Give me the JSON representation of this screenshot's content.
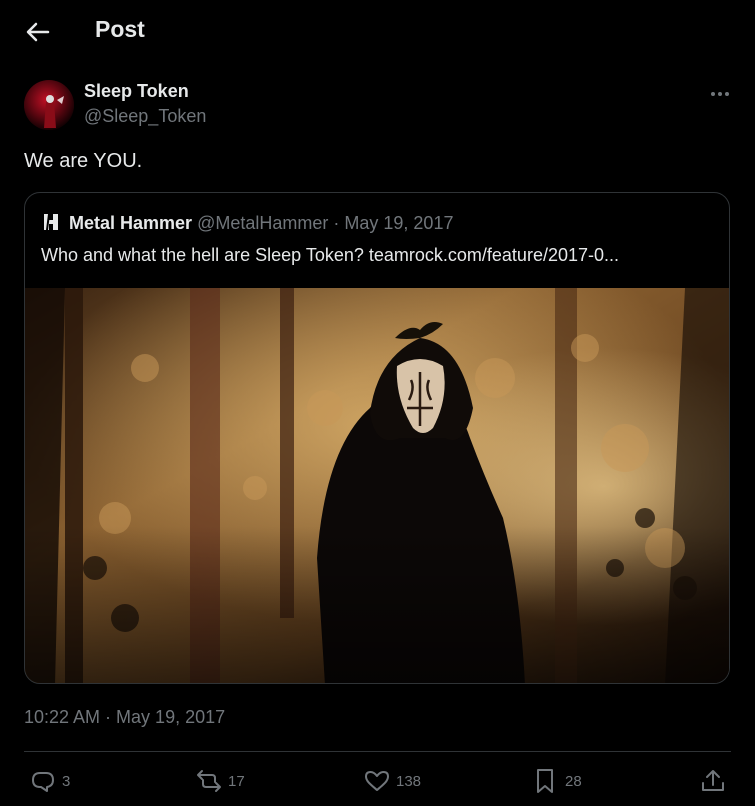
{
  "header": {
    "title": "Post"
  },
  "author": {
    "name": "Sleep Token",
    "handle": "@Sleep_Token"
  },
  "tweet": {
    "text": "We are YOU."
  },
  "quote": {
    "name": "Metal Hammer",
    "handle": "@MetalHammer",
    "date": "May 19, 2017",
    "text": "Who and what the hell are Sleep Token? teamrock.com/feature/2017-0..."
  },
  "timestamp": "10:22 AM · May 19, 2017",
  "actions": {
    "replies": "3",
    "reposts": "17",
    "likes": "138",
    "bookmarks": "28"
  },
  "icons": {
    "back": "arrow-left-icon",
    "more": "more-horizontal-icon",
    "reply": "reply-icon",
    "repost": "repost-icon",
    "like": "heart-icon",
    "bookmark": "bookmark-icon",
    "share": "share-icon"
  },
  "colors": {
    "background": "#000000",
    "text": "#e7e9ea",
    "muted": "#71767b",
    "border": "#2f3336"
  }
}
